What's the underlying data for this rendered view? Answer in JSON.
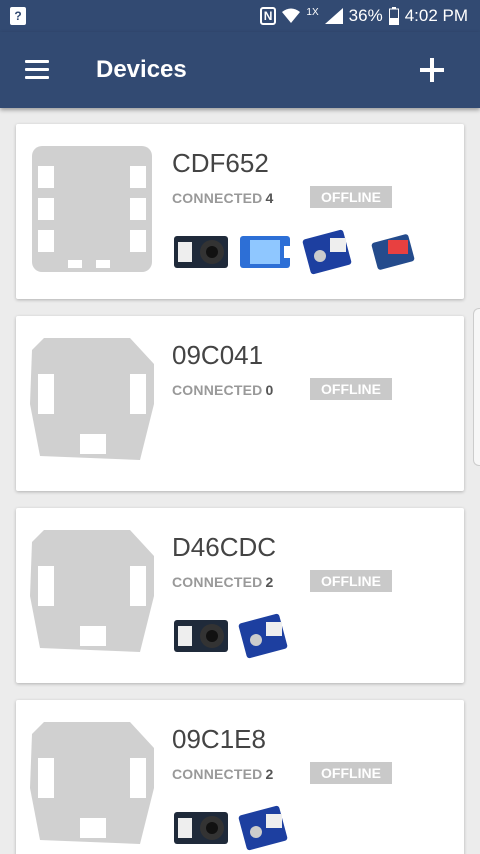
{
  "status_bar": {
    "nfc": "N",
    "network_type": "1X",
    "battery": "36%",
    "time": "4:02 PM"
  },
  "app_bar": {
    "title": "Devices",
    "menu_icon": "hamburger-menu-icon",
    "add_icon": "plus-icon"
  },
  "devices": [
    {
      "name": "CDF652",
      "connected_label": "CONNECTED",
      "connected_count": "4",
      "status": "OFFLINE",
      "modules": [
        "buzzer-module",
        "temp-humidity-sensor",
        "button-module",
        "led-bar-module"
      ]
    },
    {
      "name": "09C041",
      "connected_label": "CONNECTED",
      "connected_count": "0",
      "status": "OFFLINE",
      "modules": []
    },
    {
      "name": "D46CDC",
      "connected_label": "CONNECTED",
      "connected_count": "2",
      "status": "OFFLINE",
      "modules": [
        "buzzer-module",
        "button-module"
      ]
    },
    {
      "name": "09C1E8",
      "connected_label": "CONNECTED",
      "connected_count": "2",
      "status": "OFFLINE",
      "modules": [
        "buzzer-module",
        "button-module"
      ]
    }
  ],
  "colors": {
    "primary": "#324a72",
    "background": "#ececec",
    "badge_offline": "#c9c9c9"
  }
}
